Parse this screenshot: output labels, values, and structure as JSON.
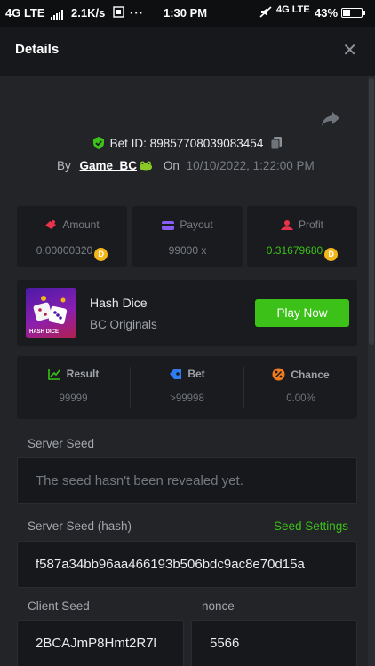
{
  "status_bar": {
    "network_left": "4G LTE",
    "speed": "2.1K/s",
    "time": "1:30 PM",
    "network_right": "4G LTE",
    "battery_level": "43%",
    "battery_fraction": 0.43
  },
  "header": {
    "title": "Details"
  },
  "bet": {
    "id_text": "Bet ID: 89857708039083454",
    "by_label": "By",
    "username": "Game_BC",
    "on_label": "On",
    "date": "10/10/2022, 1:22:00 PM"
  },
  "stats": {
    "amount_label": "Amount",
    "amount_value": "0.00000320",
    "payout_label": "Payout",
    "payout_value": "99000 x",
    "profit_label": "Profit",
    "profit_value": "0.31679680",
    "currency_symbol": "D"
  },
  "game": {
    "name": "Hash Dice",
    "provider": "BC Originals",
    "thumb_caption": "HASH DICE",
    "play_label": "Play Now"
  },
  "roll": {
    "result_label": "Result",
    "result_value": "99999",
    "bet_label": "Bet",
    "bet_value": ">99998",
    "chance_label": "Chance",
    "chance_value": "0.00%"
  },
  "seeds": {
    "server_seed_label": "Server Seed",
    "server_seed_value": "The seed hasn't been revealed yet.",
    "server_hash_label": "Server Seed (hash)",
    "seed_settings_label": "Seed Settings",
    "server_hash_value": "f587a34bb96aa466193b506bdc9ac8e70d15a",
    "client_seed_label": "Client Seed",
    "client_seed_value": "2BCAJmP8Hmt2R7l",
    "nonce_label": "nonce",
    "nonce_value": "5566"
  },
  "colors": {
    "accent_green": "#3bc117",
    "coin_gold": "#f2b619",
    "panel_bg": "#232428",
    "card_bg": "#1a1b1e"
  }
}
